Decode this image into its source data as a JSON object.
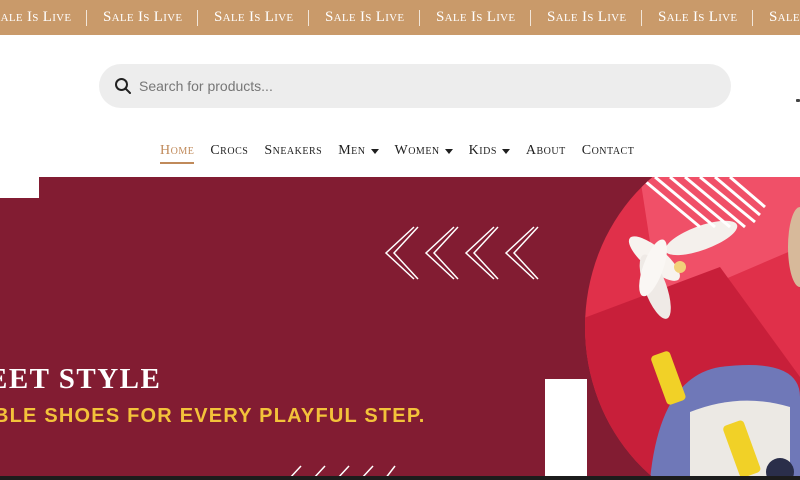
{
  "ticker": {
    "text": "Sale Is Live",
    "count": 8
  },
  "search": {
    "placeholder": "Search for products..."
  },
  "nav": {
    "items": [
      {
        "label": "Home",
        "active": true,
        "dropdown": false
      },
      {
        "label": "Crocs",
        "active": false,
        "dropdown": false
      },
      {
        "label": "Sneakers",
        "active": false,
        "dropdown": false
      },
      {
        "label": "Men",
        "active": false,
        "dropdown": true
      },
      {
        "label": "Women",
        "active": false,
        "dropdown": true
      },
      {
        "label": "Kids",
        "active": false,
        "dropdown": true
      },
      {
        "label": "About",
        "active": false,
        "dropdown": false
      },
      {
        "label": "Contact",
        "active": false,
        "dropdown": false
      }
    ]
  },
  "hero": {
    "title": "EET STYLE",
    "subtitle": "BLE SHOES FOR EVERY PLAYFUL STEP."
  },
  "icons": {
    "search": "search-icon",
    "caret": "chevron-down-icon",
    "chevrons": "chevron-left-icon"
  },
  "colors": {
    "ticker_bg": "#c99a6a",
    "hero_bg": "#821c32",
    "accent": "#c08a5a",
    "subtitle": "#f3c23a",
    "photo_red": "#e0304a"
  }
}
